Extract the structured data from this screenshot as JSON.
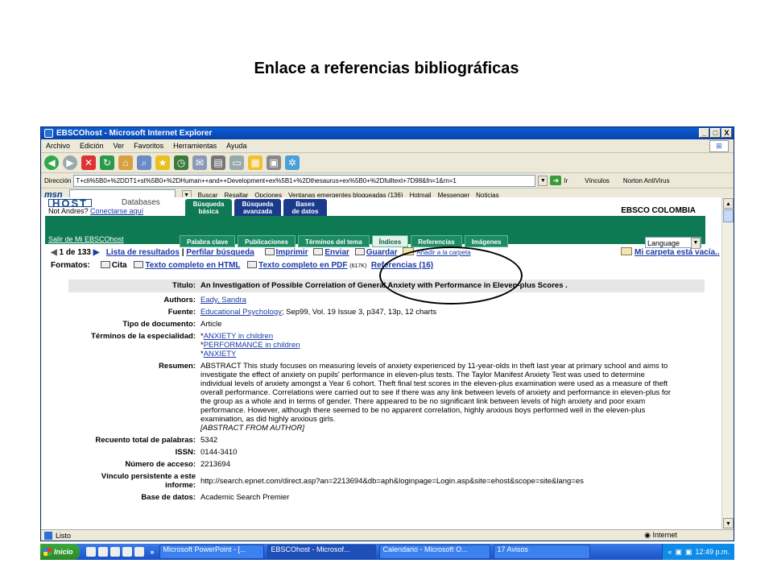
{
  "slide": {
    "title": "Enlace a referencias bibliográficas"
  },
  "window": {
    "title": "EBSCOhost - Microsoft Internet Explorer",
    "controls": {
      "minimize": "_",
      "maximize": "□",
      "close": "X"
    }
  },
  "menu": [
    "Archivo",
    "Edición",
    "Ver",
    "Favoritos",
    "Herramientas",
    "Ayuda"
  ],
  "address": {
    "label": "Dirección",
    "url": "T+cli%5B0+%2DDT1+st%5B0+%2DHuman++and++Development+ex%5B1+%2Dthesaurus+ex%5B0+%2Dfulltext+7D98&fn=1&rn=1",
    "go": "Ir",
    "links": "Vínculos",
    "norton": "Norton AntiVirus"
  },
  "msnbar": {
    "logo": "msn",
    "items": [
      "Buscar",
      "Resaltar",
      "Opciones",
      "Ventanas emergentes bloqueadas (136)",
      "Hotmail",
      "Messenger",
      "Noticias"
    ]
  },
  "ebsco": {
    "logo": "HOST",
    "logo_sub": "Databases",
    "not_user": "Not Andres?",
    "login_link": "Conectarse aquí",
    "exit_link": "Salir de Mi EBSCOhost",
    "tabs": [
      {
        "line1": "Búsqueda",
        "line2": "básica"
      },
      {
        "line1": "Búsqueda",
        "line2": "avanzada"
      },
      {
        "line1": "Bases",
        "line2": "de datos"
      }
    ],
    "subtabs": [
      "Palabra clave",
      "Publicaciones",
      "Términos del tema",
      "Índices",
      "Referencias",
      "Imágenes"
    ],
    "brand": "EBSCO COLOMBIA",
    "language": "Language"
  },
  "nav": {
    "position": "1 de 133",
    "results": "Lista de resultados",
    "refine": "Perfilar búsqueda",
    "print": "Imprimir",
    "send": "Enviar",
    "save": "Guardar",
    "add_folder": "Añadir a la carpeta",
    "folder": "Mi carpeta está vacía.."
  },
  "formats": {
    "label": "Formatos:",
    "cita": "Cita",
    "html": "Texto completo en HTML",
    "pdf": "Texto completo en PDF",
    "pdf_size": "(617K)",
    "refs": "Referencias (16)"
  },
  "record": {
    "title": {
      "label": "Título:",
      "value": "An Investigation of Possible Correlation of General Anxiety with Performance in Eleven-plus Scores ."
    },
    "authors": {
      "label": "Authors:",
      "value": "Eady, Sandra"
    },
    "source": {
      "label": "Fuente:",
      "link": "Educational Psychology",
      "rest": "; Sep99, Vol. 19 Issue 3, p347, 13p, 12 charts"
    },
    "doctype": {
      "label": "Tipo de documento:",
      "value": "Article"
    },
    "terms": {
      "label": "Términos de la especialidad:",
      "items": [
        "ANXIETY in children",
        "PERFORMANCE in children",
        "ANXIETY"
      ]
    },
    "abstract": {
      "label": "Resumen:",
      "value": "ABSTRACT This study focuses on measuring levels of anxiety experienced by 11-year-olds in theft last year at primary school and aims to investigate the effect of anxiety on pupils' performance in eleven-plus tests. The Taylor Manifest Anxiety Test was used to determine individual levels of anxiety amongst a Year 6 cohort. Theft final test scores in the eleven-plus examination were used as a measure of theft overall performance. Correlations were carried out to see if there was any link between levels of anxiety and performance in eleven-plus for the group as a whole and in terms of gender. There appeared to be no significant link between levels of high anxiety and poor exam performance. However, although there seemed to be no apparent correlation, highly anxious boys performed well in the eleven-plus examination, as did highly anxious girls.",
      "note": "[ABSTRACT FROM AUTHOR]"
    },
    "wordcount": {
      "label": "Recuento total de palabras:",
      "value": "5342"
    },
    "issn": {
      "label": "ISSN:",
      "value": "0144-3410"
    },
    "accession": {
      "label": "Número de acceso:",
      "value": "2213694"
    },
    "persistent": {
      "label1": "Vínculo persistente a este",
      "label2": "informe:",
      "value": "http://search.epnet.com/direct.asp?an=2213694&db=aph&loginpage=Login.asp&site=ehost&scope=site&lang=es"
    },
    "database": {
      "label": "Base de datos:",
      "value": "Academic Search Premier"
    }
  },
  "status": {
    "left": "Listo",
    "zone": "Internet"
  },
  "taskbar": {
    "start": "Inicio",
    "tasks": [
      "Microsoft PowerPoint - [...",
      "EBSCOhost - Microsof...",
      "Calendario - Microsoft O...",
      "17 Avisos"
    ],
    "clock": "12:49 p.m."
  },
  "colors": {
    "ebsco_green": "#0e7a54",
    "link": "#1a3aa8",
    "xp_blue": "#0a5fd8"
  }
}
